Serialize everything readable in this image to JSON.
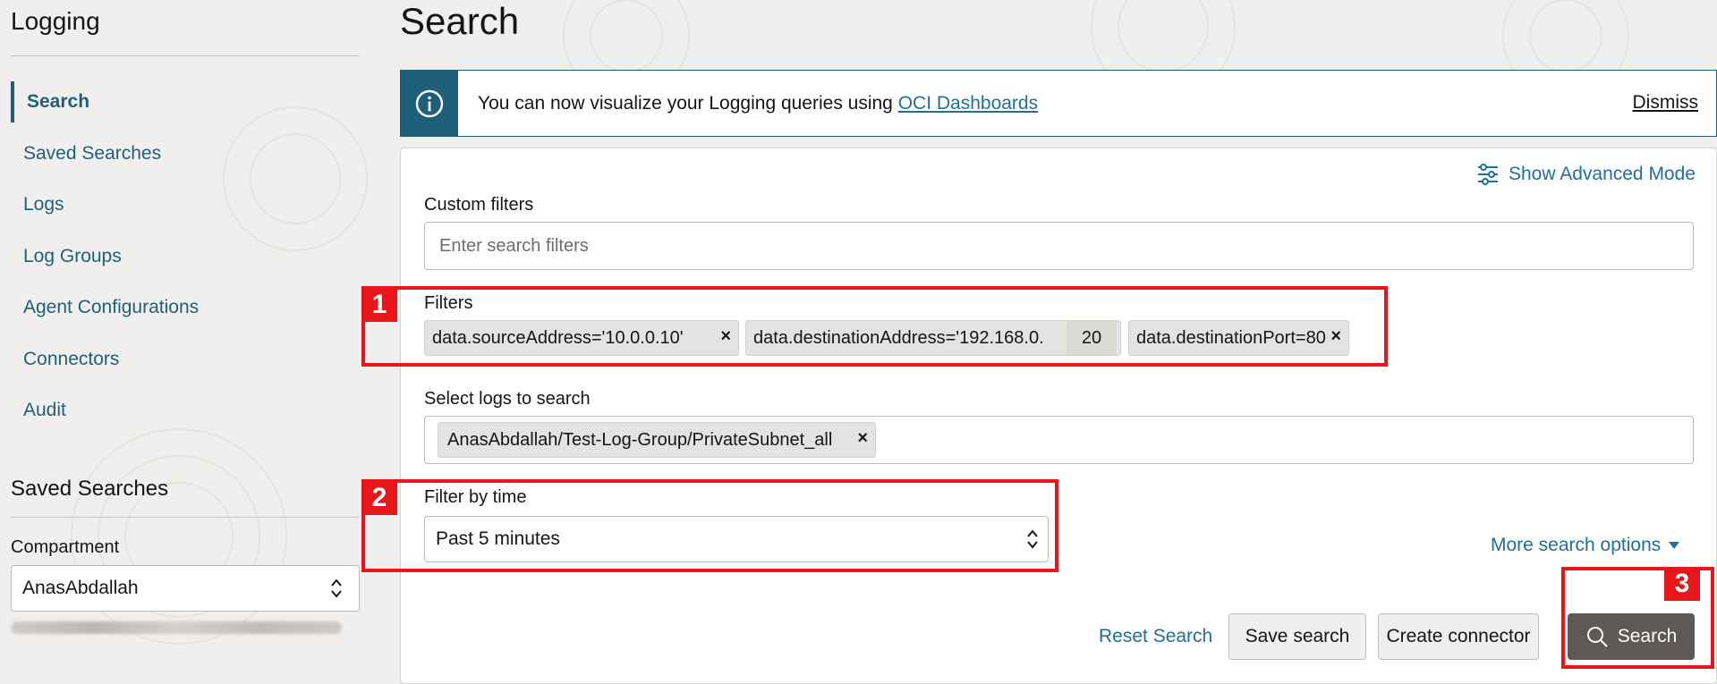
{
  "sidebar": {
    "title": "Logging",
    "nav": [
      {
        "label": "Search",
        "active": true
      },
      {
        "label": "Saved Searches"
      },
      {
        "label": "Logs"
      },
      {
        "label": "Log Groups"
      },
      {
        "label": "Agent Configurations"
      },
      {
        "label": "Connectors"
      },
      {
        "label": "Audit"
      }
    ],
    "saved_searches_title": "Saved Searches",
    "compartment_label": "Compartment",
    "compartment_value": "AnasAbdallah"
  },
  "main": {
    "title": "Search",
    "banner": {
      "text": "You can now visualize your Logging queries using ",
      "link": "OCI Dashboards",
      "dismiss": "Dismiss"
    },
    "advanced_mode": "Show Advanced Mode",
    "custom_filters": {
      "label": "Custom filters",
      "placeholder": "Enter search filters"
    },
    "filters": {
      "label": "Filters",
      "chips": [
        "data.sourceAddress='10.0.0.10'",
        "data.destinationAddress='192.168.0.",
        "data.destinationPort=80"
      ],
      "chip_overlay": "20",
      "remove_glyph": "×"
    },
    "logs": {
      "label": "Select logs to search",
      "selected": "AnasAbdallah/Test-Log-Group/PrivateSubnet_all"
    },
    "time": {
      "label": "Filter by time",
      "value": "Past 5 minutes"
    },
    "more_options": "More search options",
    "buttons": {
      "reset": "Reset Search",
      "save": "Save search",
      "connector": "Create connector",
      "search": "Search"
    }
  },
  "annotations": [
    "1",
    "2",
    "3"
  ],
  "colors": {
    "accent": "#1f5f7a",
    "link": "#1f6f9a",
    "annotation": "#e8161b",
    "primary_button": "#5d5955"
  }
}
